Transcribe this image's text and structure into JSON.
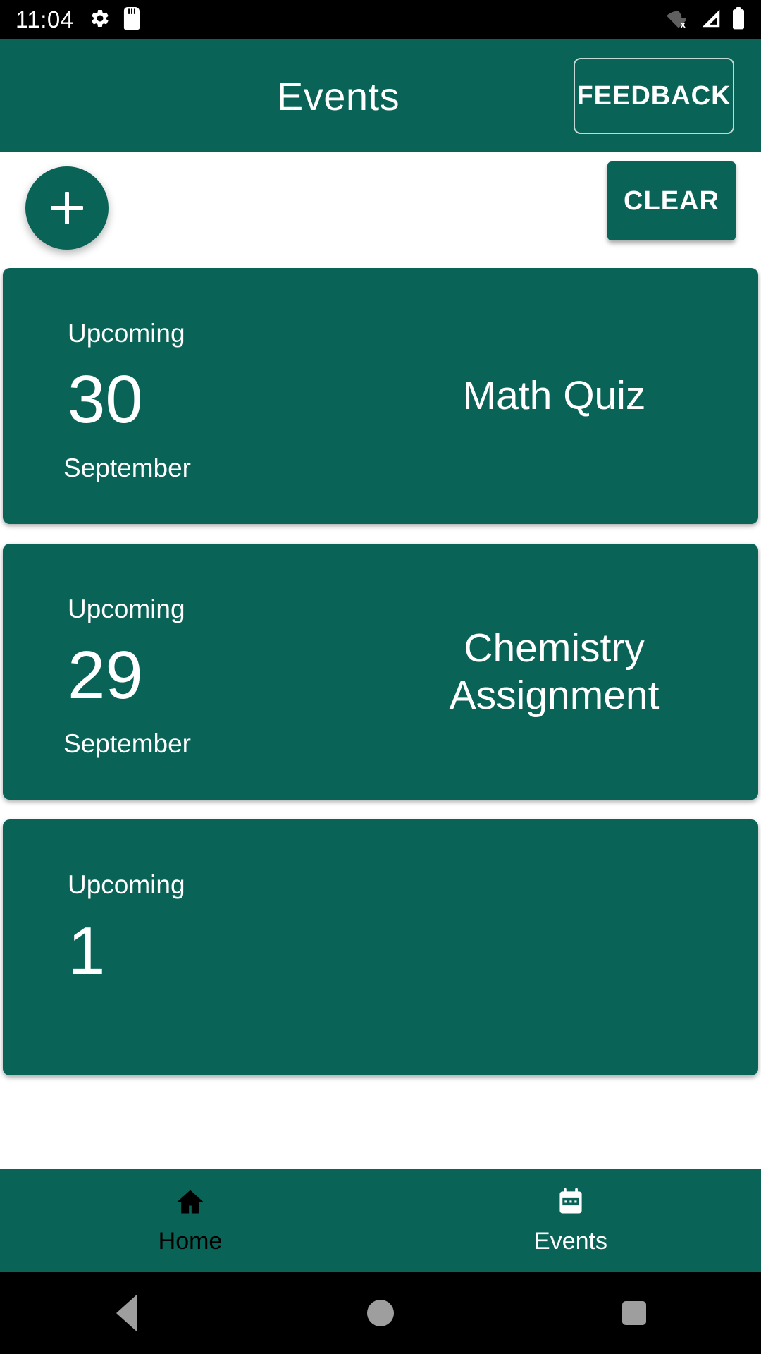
{
  "statusbar": {
    "time": "11:04",
    "icons_left": [
      "gear-icon",
      "sd-card-icon"
    ],
    "icons_right": [
      "wifi-off-icon",
      "cell-signal-icon",
      "battery-full-icon"
    ]
  },
  "appbar": {
    "title": "Events",
    "feedback_label": "FEEDBACK"
  },
  "actions": {
    "add_label": "+",
    "clear_label": "CLEAR"
  },
  "events": [
    {
      "status": "Upcoming",
      "day": "30",
      "month": "September",
      "title": "Math Quiz"
    },
    {
      "status": "Upcoming",
      "day": "29",
      "month": "September",
      "title": "Chemistry Assignment"
    },
    {
      "status": "Upcoming",
      "day": "1",
      "month": "",
      "title": ""
    }
  ],
  "bottomnav": {
    "items": [
      {
        "label": "Home",
        "icon": "home-icon",
        "active": false
      },
      {
        "label": "Events",
        "icon": "calendar-icon",
        "active": true
      }
    ]
  },
  "colors": {
    "primary": "#0a6357",
    "surface": "#ffffff",
    "on_primary": "#ffffff",
    "status_bar": "#000000",
    "nav_inactive": "#000000"
  }
}
